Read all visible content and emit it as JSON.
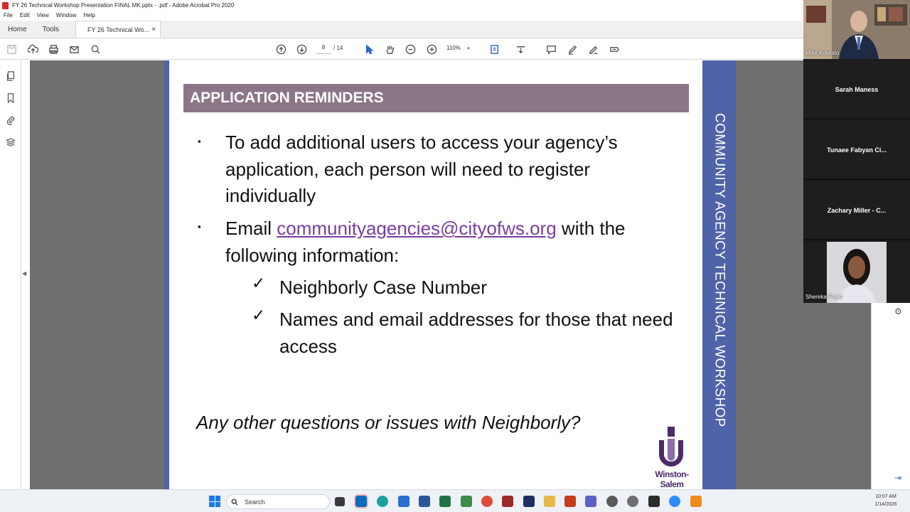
{
  "window": {
    "title": "FY 26 Technical Workshop Presentation FINAL MK.pptx  -  .pdf - Adobe Acrobat Pro 2020",
    "menu": [
      "File",
      "Edit",
      "View",
      "Window",
      "Help"
    ]
  },
  "tabs": {
    "home": "Home",
    "tools": "Tools",
    "document": "FY 26 Technical Wo...",
    "close": "×"
  },
  "toolbar": {
    "current_page": "8",
    "total_pages": "/ 14",
    "zoom": "110%"
  },
  "slide": {
    "header": "APPLICATION REMINDERS",
    "bullet1": "To add additional users to access your agency’s application, each person will need to register individually",
    "bullet2_prefix": "Email ",
    "bullet2_link": "communityagencies@cityofws.org",
    "bullet2_suffix": " with the following information:",
    "sub1": "Neighborly Case Number",
    "sub2": "Names and email addresses for those that need access",
    "closing": "Any other questions or issues with Neighborly?",
    "sidebar": "COMMUNITY AGENCY TECHNICAL WORKSHOP",
    "logo_text": "Winston-Salem",
    "bullet_marker": "▪",
    "check_marker": "✓"
  },
  "participants": [
    {
      "name": "Mike Koivisto",
      "video": true
    },
    {
      "name": "Sarah Maness",
      "video": false
    },
    {
      "name": "Tunaee Fabyan Ci...",
      "video": false
    },
    {
      "name": "Zachary Miller - C...",
      "video": false
    },
    {
      "name": "Shereka Floyd",
      "video": true
    }
  ],
  "taskbar": {
    "search_placeholder": "Search",
    "time": "10:07 AM",
    "date": "1/14/2026"
  },
  "colors": {
    "slide_header": "#8b7687",
    "slide_band": "#4f63a8",
    "link": "#7a3da0",
    "logo": "#4b2a6a"
  }
}
